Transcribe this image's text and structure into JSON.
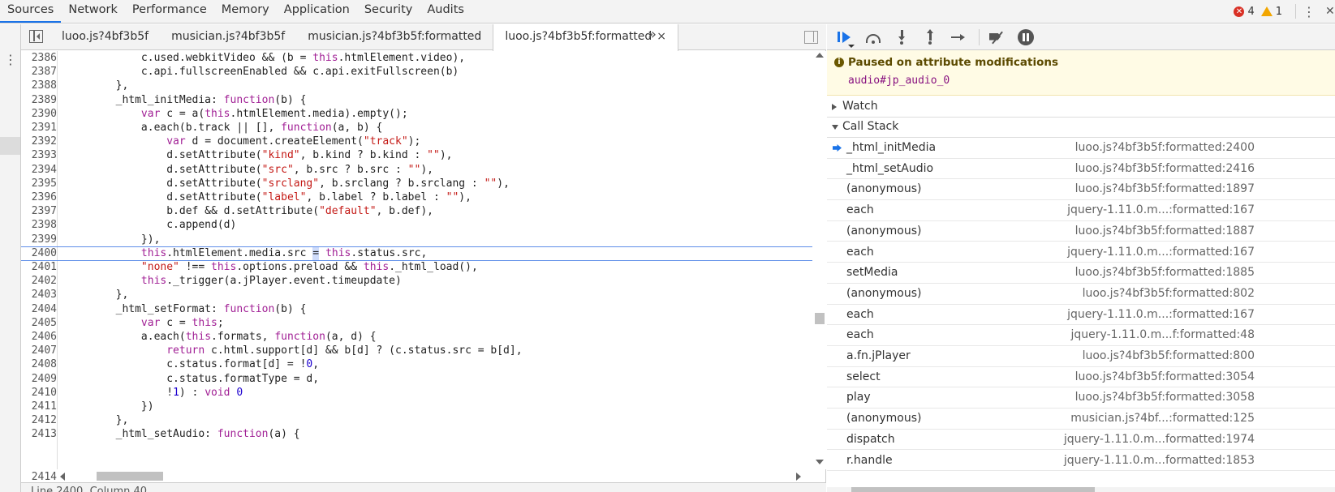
{
  "top_tabs": [
    "Sources",
    "Network",
    "Performance",
    "Memory",
    "Application",
    "Security",
    "Audits"
  ],
  "counts": {
    "errors": "4",
    "warnings": "1"
  },
  "file_tabs": [
    {
      "label": "luoo.js?4bf3b5f"
    },
    {
      "label": "musician.js?4bf3b5f"
    },
    {
      "label": "musician.js?4bf3b5f:formatted"
    },
    {
      "label": "luoo.js?4bf3b5f:formatted",
      "close": "×"
    }
  ],
  "more_tabs": "»",
  "code": [
    {
      "n": "2386",
      "t": [
        [
          "tx",
          "            c.used.webkitVideo && (b = "
        ],
        [
          "kw",
          "this"
        ],
        [
          "tx",
          ".htmlElement.video),"
        ]
      ]
    },
    {
      "n": "2387",
      "t": [
        [
          "tx",
          "            c.api.fullscreenEnabled && c.api.exitFullscreen(b)"
        ]
      ]
    },
    {
      "n": "2388",
      "t": [
        [
          "tx",
          "        },"
        ]
      ]
    },
    {
      "n": "2389",
      "t": [
        [
          "tx",
          "        _html_initMedia: "
        ],
        [
          "kw",
          "function"
        ],
        [
          "tx",
          "(b) {"
        ]
      ]
    },
    {
      "n": "2390",
      "t": [
        [
          "tx",
          "            "
        ],
        [
          "kw",
          "var"
        ],
        [
          "tx",
          " c = a("
        ],
        [
          "kw",
          "this"
        ],
        [
          "tx",
          ".htmlElement.media).empty();"
        ]
      ]
    },
    {
      "n": "2391",
      "t": [
        [
          "tx",
          "            a.each(b.track || [], "
        ],
        [
          "kw",
          "function"
        ],
        [
          "tx",
          "(a, b) {"
        ]
      ]
    },
    {
      "n": "2392",
      "t": [
        [
          "tx",
          "                "
        ],
        [
          "kw",
          "var"
        ],
        [
          "tx",
          " d = document.createElement("
        ],
        [
          "st",
          "\"track\""
        ],
        [
          "tx",
          ");"
        ]
      ]
    },
    {
      "n": "2393",
      "t": [
        [
          "tx",
          "                d.setAttribute("
        ],
        [
          "st",
          "\"kind\""
        ],
        [
          "tx",
          ", b.kind ? b.kind : "
        ],
        [
          "st",
          "\"\""
        ],
        [
          "tx",
          "),"
        ]
      ]
    },
    {
      "n": "2394",
      "t": [
        [
          "tx",
          "                d.setAttribute("
        ],
        [
          "st",
          "\"src\""
        ],
        [
          "tx",
          ", b.src ? b.src : "
        ],
        [
          "st",
          "\"\""
        ],
        [
          "tx",
          "),"
        ]
      ]
    },
    {
      "n": "2395",
      "t": [
        [
          "tx",
          "                d.setAttribute("
        ],
        [
          "st",
          "\"srclang\""
        ],
        [
          "tx",
          ", b.srclang ? b.srclang : "
        ],
        [
          "st",
          "\"\""
        ],
        [
          "tx",
          "),"
        ]
      ]
    },
    {
      "n": "2396",
      "t": [
        [
          "tx",
          "                d.setAttribute("
        ],
        [
          "st",
          "\"label\""
        ],
        [
          "tx",
          ", b.label ? b.label : "
        ],
        [
          "st",
          "\"\""
        ],
        [
          "tx",
          "),"
        ]
      ]
    },
    {
      "n": "2397",
      "t": [
        [
          "tx",
          "                b.def && d.setAttribute("
        ],
        [
          "st",
          "\"default\""
        ],
        [
          "tx",
          ", b.def),"
        ]
      ]
    },
    {
      "n": "2398",
      "t": [
        [
          "tx",
          "                c.append(d)"
        ]
      ]
    },
    {
      "n": "2399",
      "t": [
        [
          "tx",
          "            }),"
        ]
      ]
    },
    {
      "n": "2400",
      "hl": true,
      "t": [
        [
          "tx",
          "            "
        ],
        [
          "kw",
          "this"
        ],
        [
          "tx",
          ".htmlElement.media.src "
        ],
        [
          "cur",
          "="
        ],
        [
          "tx",
          " "
        ],
        [
          "kw",
          "this"
        ],
        [
          "tx",
          ".status.src,"
        ]
      ]
    },
    {
      "n": "2401",
      "t": [
        [
          "tx",
          "            "
        ],
        [
          "st",
          "\"none\""
        ],
        [
          "tx",
          " !== "
        ],
        [
          "kw",
          "this"
        ],
        [
          "tx",
          ".options.preload && "
        ],
        [
          "kw",
          "this"
        ],
        [
          "tx",
          "._html_load(),"
        ]
      ]
    },
    {
      "n": "2402",
      "t": [
        [
          "tx",
          "            "
        ],
        [
          "kw",
          "this"
        ],
        [
          "tx",
          "._trigger(a.jPlayer.event.timeupdate)"
        ]
      ]
    },
    {
      "n": "2403",
      "t": [
        [
          "tx",
          "        },"
        ]
      ]
    },
    {
      "n": "2404",
      "t": [
        [
          "tx",
          "        _html_setFormat: "
        ],
        [
          "kw",
          "function"
        ],
        [
          "tx",
          "(b) {"
        ]
      ]
    },
    {
      "n": "2405",
      "t": [
        [
          "tx",
          "            "
        ],
        [
          "kw",
          "var"
        ],
        [
          "tx",
          " c = "
        ],
        [
          "kw",
          "this"
        ],
        [
          "tx",
          ";"
        ]
      ]
    },
    {
      "n": "2406",
      "t": [
        [
          "tx",
          "            a.each("
        ],
        [
          "kw",
          "this"
        ],
        [
          "tx",
          ".formats, "
        ],
        [
          "kw",
          "function"
        ],
        [
          "tx",
          "(a, d) {"
        ]
      ]
    },
    {
      "n": "2407",
      "t": [
        [
          "tx",
          "                "
        ],
        [
          "kw",
          "return"
        ],
        [
          "tx",
          " c.html.support[d] && b[d] ? (c.status.src = b[d],"
        ]
      ]
    },
    {
      "n": "2408",
      "t": [
        [
          "tx",
          "                c.status.format[d] = !"
        ],
        [
          "nm",
          "0"
        ],
        [
          "tx",
          ","
        ]
      ]
    },
    {
      "n": "2409",
      "t": [
        [
          "tx",
          "                c.status.formatType = d,"
        ]
      ]
    },
    {
      "n": "2410",
      "t": [
        [
          "tx",
          "                !"
        ],
        [
          "nm",
          "1"
        ],
        [
          "tx",
          ") : "
        ],
        [
          "kw",
          "void"
        ],
        [
          "tx",
          " "
        ],
        [
          "nm",
          "0"
        ]
      ]
    },
    {
      "n": "2411",
      "t": [
        [
          "tx",
          "            })"
        ]
      ]
    },
    {
      "n": "2412",
      "t": [
        [
          "tx",
          "        },"
        ]
      ]
    },
    {
      "n": "2413",
      "t": [
        [
          "tx",
          "        _html_setAudio: "
        ],
        [
          "kw",
          "function"
        ],
        [
          "tx",
          "(a) {"
        ]
      ]
    }
  ],
  "last_gutter": "2414",
  "status_text": "Line 2400, Column 40",
  "paused": {
    "icon": "i",
    "title": "Paused on attribute modifications",
    "node": "audio#jp_audio_0"
  },
  "sections": {
    "watch": "Watch",
    "call_stack": "Call Stack"
  },
  "call_stack": [
    {
      "fn": "_html_initMedia",
      "loc": "luoo.js?4bf3b5f:formatted:2400",
      "current": true
    },
    {
      "fn": "_html_setAudio",
      "loc": "luoo.js?4bf3b5f:formatted:2416"
    },
    {
      "fn": "(anonymous)",
      "loc": "luoo.js?4bf3b5f:formatted:1897"
    },
    {
      "fn": "each",
      "loc": "jquery-1.11.0.m...:formatted:167"
    },
    {
      "fn": "(anonymous)",
      "loc": "luoo.js?4bf3b5f:formatted:1887"
    },
    {
      "fn": "each",
      "loc": "jquery-1.11.0.m...:formatted:167"
    },
    {
      "fn": "setMedia",
      "loc": "luoo.js?4bf3b5f:formatted:1885"
    },
    {
      "fn": "(anonymous)",
      "loc": "luoo.js?4bf3b5f:formatted:802"
    },
    {
      "fn": "each",
      "loc": "jquery-1.11.0.m...:formatted:167"
    },
    {
      "fn": "each",
      "loc": "jquery-1.11.0.m...f:formatted:48"
    },
    {
      "fn": "a.fn.jPlayer",
      "loc": "luoo.js?4bf3b5f:formatted:800"
    },
    {
      "fn": "select",
      "loc": "luoo.js?4bf3b5f:formatted:3054"
    },
    {
      "fn": "play",
      "loc": "luoo.js?4bf3b5f:formatted:3058"
    },
    {
      "fn": "(anonymous)",
      "loc": "musician.js?4bf...:formatted:125"
    },
    {
      "fn": "dispatch",
      "loc": "jquery-1.11.0.m...formatted:1974"
    },
    {
      "fn": "r.handle",
      "loc": "jquery-1.11.0.m...formatted:1853"
    }
  ],
  "colors": {
    "accent": "#1a73e8",
    "keyword": "#a12095",
    "string": "#c41a16",
    "number": "#1c00cf",
    "paused_bg": "#fffbe5"
  }
}
